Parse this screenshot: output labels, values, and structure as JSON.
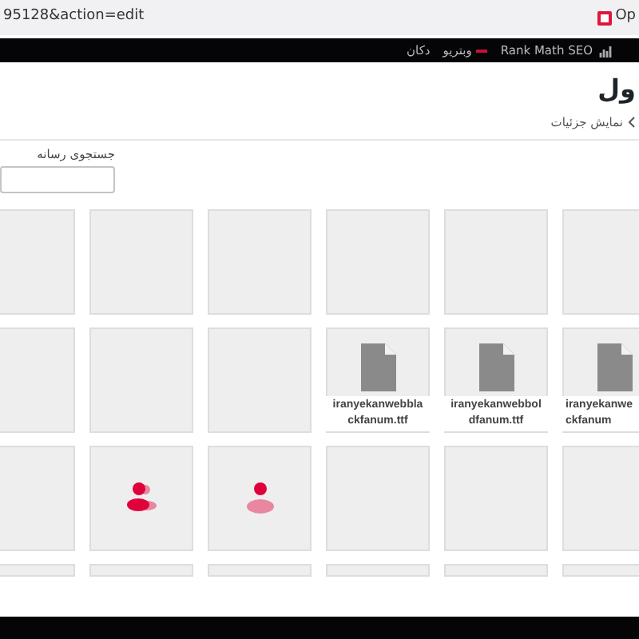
{
  "browser": {
    "url": "95128&action=edit",
    "tab_label": "Op"
  },
  "admin_bar": {
    "items": [
      {
        "label": "Rank Math SEO",
        "kind": "seo"
      },
      {
        "label": "وبتريو",
        "kind": "notice"
      },
      {
        "label": "دکان",
        "kind": "text"
      }
    ]
  },
  "page": {
    "title": "ول",
    "breadcrumb": "نمایش جزئیات"
  },
  "search": {
    "label": "جستجوی رسانه"
  },
  "media_rows": [
    [
      {
        "kind": "blank"
      },
      {
        "kind": "blank"
      },
      {
        "kind": "blank"
      },
      {
        "kind": "blank"
      },
      {
        "kind": "blank"
      },
      {
        "kind": "blank"
      }
    ],
    [
      {
        "kind": "file",
        "lines": [
          "iranyekanwe",
          "ckfanum"
        ]
      },
      {
        "kind": "file",
        "lines": [
          "iranyekanwebbol",
          "dfanum.ttf"
        ]
      },
      {
        "kind": "file",
        "lines": [
          "iranyekanwebbla",
          "ckfanum.ttf"
        ]
      },
      {
        "kind": "blank"
      },
      {
        "kind": "blank"
      },
      {
        "kind": "blank"
      }
    ],
    [
      {
        "kind": "blank"
      },
      {
        "kind": "blank"
      },
      {
        "kind": "blank"
      },
      {
        "kind": "person"
      },
      {
        "kind": "people"
      },
      {
        "kind": "blank"
      }
    ],
    [
      {
        "kind": "blank"
      },
      {
        "kind": "blank"
      },
      {
        "kind": "blank"
      },
      {
        "kind": "blank"
      },
      {
        "kind": "blank"
      },
      {
        "kind": "blank"
      }
    ]
  ]
}
